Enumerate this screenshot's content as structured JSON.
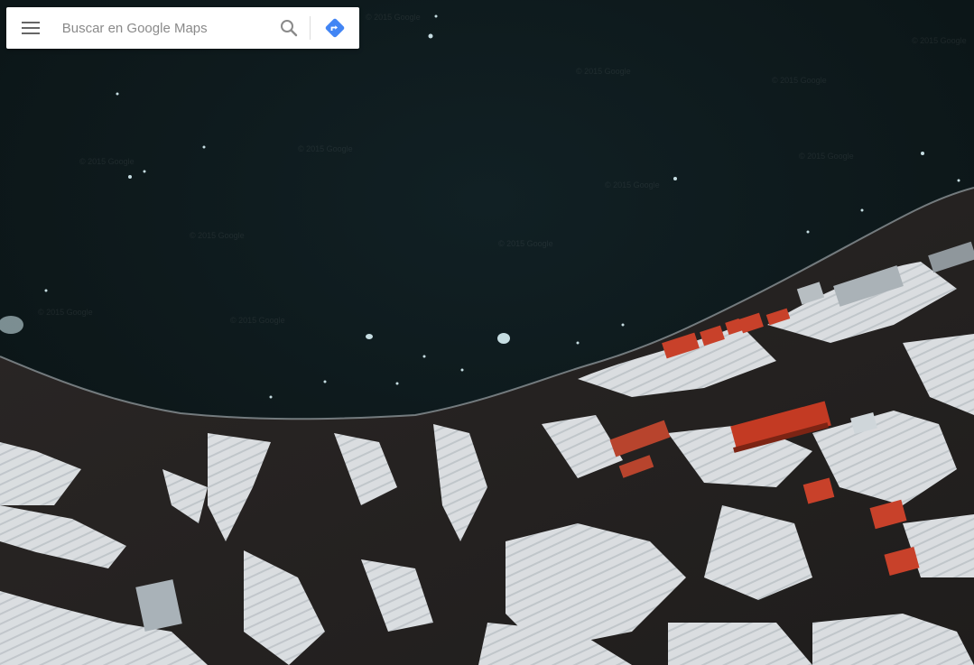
{
  "search": {
    "placeholder": "Buscar en Google Maps",
    "value": ""
  },
  "icons": {
    "menu": "hamburger-menu-icon",
    "search": "magnifier-icon",
    "directions": "directions-diamond-icon"
  },
  "colors": {
    "water": "#0d1416",
    "snow": "#e6e9ec",
    "rock": "#2a2827",
    "roof_red": "#c8412a",
    "directions_blue": "#4285f4"
  },
  "watermark": "© 2015 Google"
}
